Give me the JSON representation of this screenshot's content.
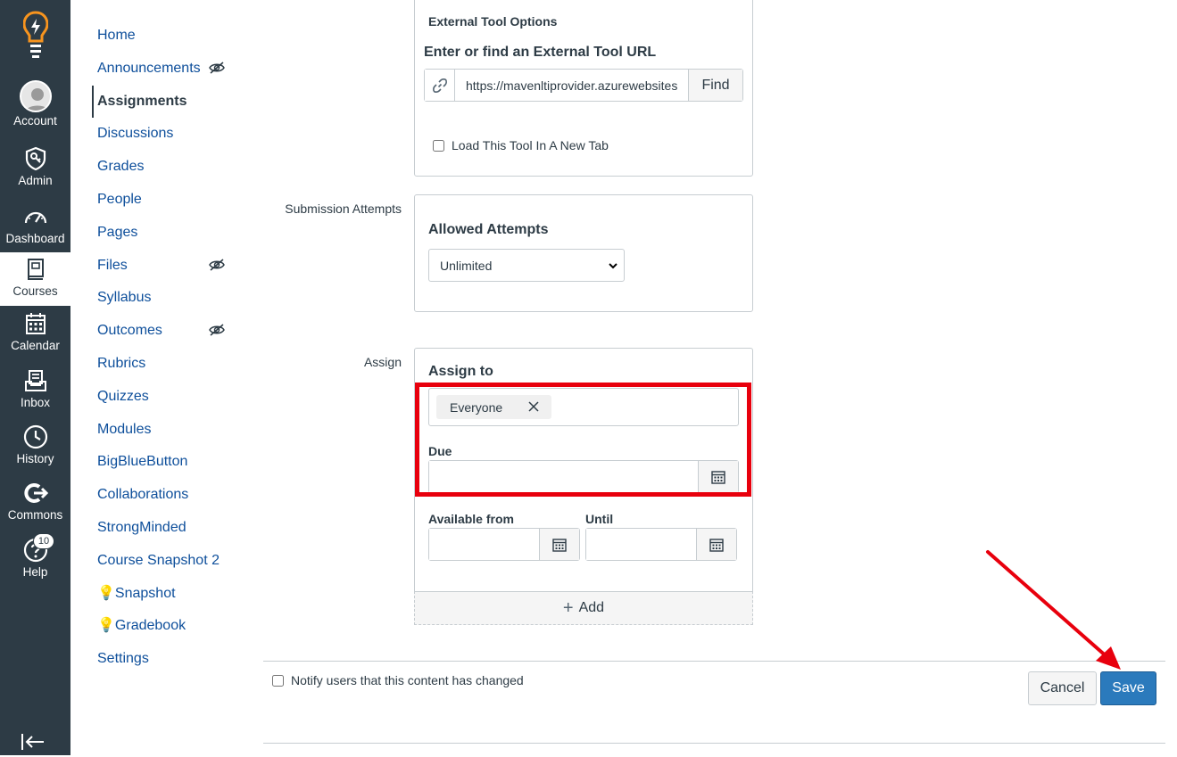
{
  "global_nav": {
    "items": [
      {
        "label": "Account",
        "icon": "user-avatar"
      },
      {
        "label": "Admin",
        "icon": "shield-key-icon"
      },
      {
        "label": "Dashboard",
        "icon": "speedometer-icon"
      },
      {
        "label": "Courses",
        "icon": "book-icon"
      },
      {
        "label": "Calendar",
        "icon": "calendar-icon"
      },
      {
        "label": "Inbox",
        "icon": "inbox-icon"
      },
      {
        "label": "History",
        "icon": "clock-icon"
      },
      {
        "label": "Commons",
        "icon": "commons-icon"
      },
      {
        "label": "Help",
        "icon": "help-icon"
      }
    ],
    "help_badge": "10"
  },
  "course_nav": {
    "items": [
      {
        "label": "Home"
      },
      {
        "label": "Announcements"
      },
      {
        "label": "Assignments"
      },
      {
        "label": "Discussions"
      },
      {
        "label": "Grades"
      },
      {
        "label": "People"
      },
      {
        "label": "Pages"
      },
      {
        "label": "Files"
      },
      {
        "label": "Syllabus"
      },
      {
        "label": "Outcomes"
      },
      {
        "label": "Rubrics"
      },
      {
        "label": "Quizzes"
      },
      {
        "label": "Modules"
      },
      {
        "label": "BigBlueButton"
      },
      {
        "label": "Collaborations"
      },
      {
        "label": "StrongMinded"
      },
      {
        "label": "Course Snapshot 2"
      },
      {
        "label": "💡Snapshot"
      },
      {
        "label": "💡Gradebook"
      },
      {
        "label": "Settings"
      }
    ]
  },
  "external_tool": {
    "title": "External Tool Options",
    "url_label": "Enter or find an External Tool URL",
    "url_value": "https://mavenltiprovider.azurewebsites",
    "find_label": "Find",
    "new_tab_label": "Load This Tool In A New Tab"
  },
  "submission_attempts": {
    "label": "Submission Attempts",
    "title": "Allowed Attempts",
    "selected": "Unlimited"
  },
  "assign": {
    "label": "Assign",
    "title": "Assign to",
    "token": "Everyone",
    "due_label": "Due",
    "available_from_label": "Available from",
    "until_label": "Until",
    "add_label": "Add"
  },
  "footer": {
    "notify_label": "Notify users that this content has changed",
    "cancel_label": "Cancel",
    "save_label": "Save"
  },
  "colors": {
    "nav_bg": "#2d3b45",
    "link": "#0e4f9b",
    "primary": "#2b7abc",
    "highlight": "#e8000d"
  }
}
